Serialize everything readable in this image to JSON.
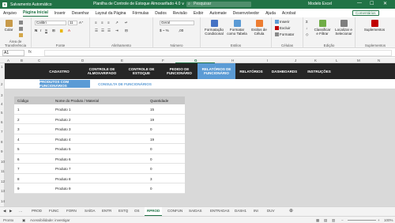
{
  "titlebar": {
    "autosave": "Salvamento Automático",
    "title": "Planilha de Controle de Estoque Almoxarifado 4.0 ∨",
    "search_placeholder": "Pesquisar",
    "user": "Modelo Excel",
    "min": "—",
    "max": "☐",
    "close": "✕"
  },
  "ribbon_tabs": [
    "Arquivo",
    "Página Inicial",
    "Inserir",
    "Desenhar",
    "Layout da Página",
    "Fórmulas",
    "Dados",
    "Revisão",
    "Exibir",
    "Automate",
    "Desenvolvedor",
    "Ajuda",
    "Acrobat"
  ],
  "comments_button": "Comentários",
  "ribbon": {
    "paste": "Colar",
    "clipboard_label": "Área de Transferência",
    "font_name": "Calibri",
    "font_size": "11",
    "font_label": "Fonte",
    "align_label": "Alinhamento",
    "number_format": "Geral",
    "number_label": "Número",
    "cond_format": "Formatação Condicional",
    "format_table": "Formatar como Tabela",
    "cell_styles": "Estilos de Célula",
    "styles_label": "Estilos",
    "insert": "Inserir",
    "delete": "Excluir",
    "format": "Formatar",
    "cells_label": "Células",
    "sort_filter": "Classificar e Filtrar",
    "find_select": "Localizar e Selecionar",
    "edit_label": "Edição",
    "addins": "Suplementos",
    "addins_label": "Suplementos"
  },
  "formula_bar": {
    "name_box": "A1",
    "fx": "fx"
  },
  "column_headers": [
    "A",
    "B",
    "C",
    "D",
    "E",
    "F",
    "G",
    "H",
    "I",
    "J",
    "K",
    "L",
    "M",
    "N"
  ],
  "row_headers": [
    "1",
    "2",
    "3",
    "4",
    "5",
    "6",
    "7",
    "8",
    "9",
    "10",
    "11",
    "12",
    "13",
    "14",
    "15",
    "16"
  ],
  "nav": [
    {
      "label": "CADASTRO",
      "active": false
    },
    {
      "label": "CONTROLE DE ALMOXARIFADO",
      "active": false
    },
    {
      "label": "CONTROLE DE ESTOQUE",
      "active": false
    },
    {
      "label": "PEDIDO DE FUNCIONÁRIO",
      "active": false
    },
    {
      "label": "RELATÓRIOS DE FUNCIONÁRIO",
      "active": true
    },
    {
      "label": "RELATÓRIOS",
      "active": false
    },
    {
      "label": "DASHBOARDS",
      "active": false
    },
    {
      "label": "INSTRUÇÕES",
      "active": false
    }
  ],
  "subtabs": [
    "PRODUTOS COM FUNCIONÁRIOS",
    "CONSULTA DE FUNCIONÁRIOS"
  ],
  "table": {
    "headers": [
      "Código",
      "Nome do Produto / Material",
      "Quantidade"
    ],
    "rows": [
      [
        "1",
        "Produto 1",
        "15"
      ],
      [
        "2",
        "Produto 2",
        "19"
      ],
      [
        "3",
        "Produto 3",
        "0"
      ],
      [
        "4",
        "Produto 4",
        "19"
      ],
      [
        "5",
        "Produto 5",
        "0"
      ],
      [
        "6",
        "Produto 6",
        "0"
      ],
      [
        "7",
        "Produto 7",
        "0"
      ],
      [
        "8",
        "Produto 8",
        "3"
      ],
      [
        "9",
        "Produto 9",
        "0"
      ]
    ]
  },
  "sheet_tabs": [
    "PROD",
    "FUNC",
    "FORN",
    "SAÍDA",
    "ENTR",
    "ESTQ",
    "OS",
    "RPROD",
    "CONFUN",
    "SAIDAS",
    "ENTRADAS",
    "DASH1",
    "INI",
    "DUV"
  ],
  "active_sheet": "RPROD",
  "statusbar": {
    "ready": "Pronto",
    "accessibility": "Acessibilidade: investigar",
    "zoom": "100%"
  },
  "colors": {
    "excel_green": "#217346",
    "nav_dark": "#262626",
    "nav_active": "#5b9bd5",
    "content_bg": "#d9d9d9"
  }
}
